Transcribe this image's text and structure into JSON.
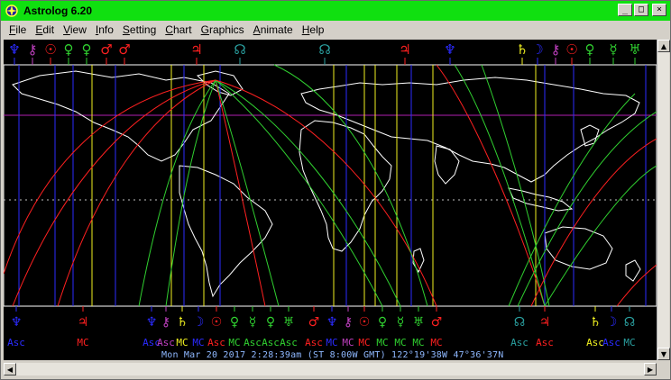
{
  "window": {
    "title": "Astrolog 6.20",
    "min_symbol": "_",
    "max_symbol": "□",
    "close_symbol": "×"
  },
  "menu": [
    {
      "u": "F",
      "rest": "ile"
    },
    {
      "u": "E",
      "rest": "dit"
    },
    {
      "u": "V",
      "rest": "iew"
    },
    {
      "u": "I",
      "rest": "nfo"
    },
    {
      "u": "S",
      "rest": "etting"
    },
    {
      "u": "C",
      "rest": "hart"
    },
    {
      "u": "G",
      "rest": "raphics"
    },
    {
      "u": "A",
      "rest": "nimate"
    },
    {
      "u": "H",
      "rest": "elp"
    }
  ],
  "timestamp": "Mon Mar 20 2017  2:28:39am (ST 8:00W GMT) 122°19'38W 47°36'37N",
  "colors": {
    "blue": "#2b2bff",
    "yellow": "#f0f020",
    "red": "#ff2020",
    "green": "#30d030",
    "magenta": "#c040c0",
    "cyan": "#2aa0a0",
    "purple_line": "#b020b0",
    "coast": "#ffffff"
  },
  "top_glyphs": [
    {
      "g": "♆",
      "c": "blue"
    },
    {
      "g": "⚷",
      "c": "magenta"
    },
    {
      "g": "☉",
      "c": "red"
    },
    {
      "g": "♀",
      "c": "green"
    },
    {
      "g": "♀",
      "c": "green"
    },
    {
      "g": "♂",
      "c": "red"
    },
    {
      "g": "♂",
      "c": "red"
    },
    {
      "g": "♃",
      "c": "red"
    },
    {
      "g": "☊",
      "c": "cyan"
    },
    {
      "g": "☊",
      "c": "cyan"
    },
    {
      "g": "♃",
      "c": "red"
    },
    {
      "g": "♆",
      "c": "blue"
    },
    {
      "g": "♄",
      "c": "yellow"
    },
    {
      "g": "☽",
      "c": "blue"
    },
    {
      "g": "⚷",
      "c": "magenta"
    },
    {
      "g": "☉",
      "c": "red"
    },
    {
      "g": "♀",
      "c": "green"
    },
    {
      "g": "☿",
      "c": "green"
    },
    {
      "g": "♅",
      "c": "green"
    }
  ],
  "bottom_groups": [
    {
      "g": "♆",
      "c": "blue",
      "l": "Asc"
    },
    {
      "g": "♃",
      "c": "red",
      "l": "MC"
    },
    {
      "g": "♆",
      "c": "blue",
      "l": "Asc"
    },
    {
      "g": "⚷",
      "c": "magenta",
      "l": "Asc"
    },
    {
      "g": "♄",
      "c": "yellow",
      "l": "MC"
    },
    {
      "g": "☽",
      "c": "blue",
      "l": "MC"
    },
    {
      "g": "☉",
      "c": "red",
      "l": "Asc"
    },
    {
      "g": "♀",
      "c": "green",
      "l": "MC"
    },
    {
      "g": "☿",
      "c": "green",
      "l": "Asc"
    },
    {
      "g": "♀",
      "c": "green",
      "l": "Asc"
    },
    {
      "g": "♅",
      "c": "green",
      "l": "Asc"
    },
    {
      "g": "♂",
      "c": "red",
      "l": "Asc"
    },
    {
      "g": "♆",
      "c": "blue",
      "l": "MC"
    },
    {
      "g": "⚷",
      "c": "magenta",
      "l": "MC"
    },
    {
      "g": "☉",
      "c": "red",
      "l": "MC"
    },
    {
      "g": "♀",
      "c": "green",
      "l": "MC"
    },
    {
      "g": "☿",
      "c": "green",
      "l": "MC"
    },
    {
      "g": "♅",
      "c": "green",
      "l": "MC"
    },
    {
      "g": "♂",
      "c": "red",
      "l": "MC"
    },
    {
      "g": "☊",
      "c": "cyan",
      "l": "Asc"
    },
    {
      "g": "♃",
      "c": "red",
      "l": "Asc"
    },
    {
      "g": "♄",
      "c": "yellow",
      "l": "Asc"
    },
    {
      "g": "☽",
      "c": "blue",
      "l": "Asc"
    },
    {
      "g": "☊",
      "c": "cyan",
      "l": "MC"
    }
  ]
}
